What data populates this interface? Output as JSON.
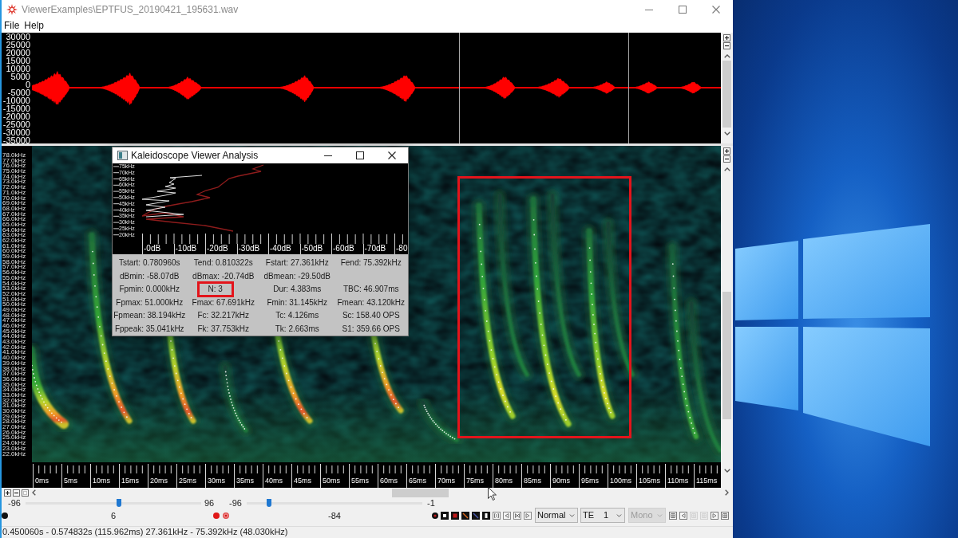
{
  "window": {
    "title": "ViewerExamples\\EPTFUS_20190421_195631.wav"
  },
  "menu": [
    "File",
    "Help"
  ],
  "waveform": {
    "y_labels": [
      "30000",
      "25000",
      "20000",
      "15000",
      "10000",
      "5000",
      "0",
      "-5000",
      "-10000",
      "-15000",
      "-20000",
      "-25000",
      "-30000",
      "-35000"
    ]
  },
  "spectrogram": {
    "freq_labels": [
      "78.0kHz",
      "77.0kHz",
      "76.0kHz",
      "75.0kHz",
      "74.0kHz",
      "73.0kHz",
      "72.0kHz",
      "71.0kHz",
      "70.0kHz",
      "69.0kHz",
      "68.0kHz",
      "67.0kHz",
      "66.0kHz",
      "65.0kHz",
      "64.0kHz",
      "63.0kHz",
      "62.0kHz",
      "61.0kHz",
      "60.0kHz",
      "59.0kHz",
      "58.0kHz",
      "57.0kHz",
      "56.0kHz",
      "55.0kHz",
      "54.0kHz",
      "53.0kHz",
      "52.0kHz",
      "51.0kHz",
      "50.0kHz",
      "49.0kHz",
      "48.0kHz",
      "47.0kHz",
      "46.0kHz",
      "45.0kHz",
      "44.0kHz",
      "43.0kHz",
      "42.0kHz",
      "41.0kHz",
      "40.0kHz",
      "39.0kHz",
      "38.0kHz",
      "37.0kHz",
      "36.0kHz",
      "35.0kHz",
      "34.0kHz",
      "33.0kHz",
      "32.0kHz",
      "31.0kHz",
      "30.0kHz",
      "29.0kHz",
      "28.0kHz",
      "27.0kHz",
      "26.0kHz",
      "25.0kHz",
      "24.0kHz",
      "23.0kHz",
      "22.0kHz"
    ],
    "time_labels": [
      "0ms",
      "5ms",
      "10ms",
      "15ms",
      "20ms",
      "25ms",
      "30ms",
      "35ms",
      "40ms",
      "45ms",
      "50ms",
      "55ms",
      "60ms",
      "65ms",
      "70ms",
      "75ms",
      "80ms",
      "85ms",
      "90ms",
      "95ms",
      "100ms",
      "105ms",
      "110ms",
      "115ms"
    ]
  },
  "analysis_window": {
    "title": "Kaleidoscope Viewer Analysis",
    "freq_labels": [
      "75kHz",
      "70kHz",
      "65kHz",
      "60kHz",
      "55kHz",
      "50kHz",
      "45kHz",
      "40kHz",
      "35kHz",
      "30kHz",
      "25kHz",
      "20kHz"
    ],
    "db_labels": [
      "-0dB",
      "-10dB",
      "-20dB",
      "-30dB",
      "-40dB",
      "-50dB",
      "-60dB",
      "-70dB",
      "-80"
    ],
    "stats": [
      [
        {
          "text": "Tstart: 0.780960s",
          "highlighted": false
        },
        {
          "text": "Tend: 0.810322s",
          "highlighted": false
        },
        {
          "text": "Fstart: 27.361kHz",
          "highlighted": false
        },
        {
          "text": "Fend: 75.392kHz",
          "highlighted": false
        }
      ],
      [
        {
          "text": "dBmin: -58.07dB",
          "highlighted": false
        },
        {
          "text": "dBmax: -20.74dB",
          "highlighted": false
        },
        {
          "text": "dBmean: -29.50dB",
          "highlighted": false
        }
      ],
      [
        {
          "text": "Fpmin: 0.000kHz",
          "highlighted": false
        },
        {
          "text": "N: 3",
          "highlighted": true
        },
        {
          "text": "Dur: 4.383ms",
          "highlighted": false
        },
        {
          "text": "TBC: 46.907ms",
          "highlighted": false
        }
      ],
      [
        {
          "text": "Fpmax: 51.000kHz",
          "highlighted": false
        },
        {
          "text": "Fmax: 67.691kHz",
          "highlighted": false
        },
        {
          "text": "Fmin: 31.145kHz",
          "highlighted": false
        },
        {
          "text": "Fmean: 43.120kHz",
          "highlighted": false
        }
      ],
      [
        {
          "text": "Fpmean: 38.194kHz",
          "highlighted": false
        },
        {
          "text": "Fc: 32.217kHz",
          "highlighted": false
        },
        {
          "text": "Tc: 4.126ms",
          "highlighted": false
        },
        {
          "text": "Sc: 158.40 OPS",
          "highlighted": false
        }
      ],
      [
        {
          "text": "Fppeak: 35.041kHz",
          "highlighted": false
        },
        {
          "text": "Fk: 37.753kHz",
          "highlighted": false
        },
        {
          "text": "Tk: 2.663ms",
          "highlighted": false
        },
        {
          "text": "S1: 359.66 OPS",
          "highlighted": false
        }
      ]
    ]
  },
  "sliders": [
    {
      "min": "-96",
      "max": "96",
      "value": "6",
      "level": 0.531
    },
    {
      "min": "-96",
      "max": "-1",
      "value": "-84",
      "level": 0.126
    }
  ],
  "dropdowns": [
    {
      "value": "Normal",
      "disabled": false
    },
    {
      "value": "TE",
      "number": "1",
      "disabled": false
    },
    {
      "value": "Mono",
      "disabled": true
    }
  ],
  "view_buttons": [
    {
      "disabled": false
    },
    {
      "disabled": false
    },
    {
      "disabled": true
    },
    {
      "disabled": true
    },
    {
      "disabled": false
    },
    {
      "disabled": false
    }
  ],
  "status_bar": "0.450060s - 0.574832s (115.962ms) 27.361kHz - 75.392kHz (48.030kHz)"
}
